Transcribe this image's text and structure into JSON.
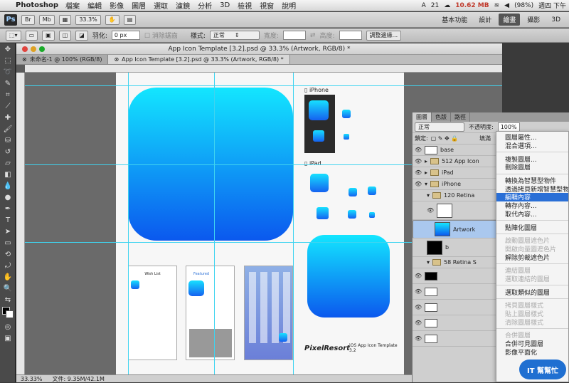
{
  "menubar": {
    "app": "Photoshop",
    "items": [
      "檔案",
      "編輯",
      "影像",
      "圖層",
      "選取",
      "濾鏡",
      "分析",
      "3D",
      "檢視",
      "視窗",
      "說明"
    ],
    "status": {
      "ai": "21",
      "mem": "10.62 MB",
      "battery": "(98%)",
      "clock": "週四 下午"
    }
  },
  "appbar": {
    "logo": "Ps",
    "br": "Br",
    "mb": "Mb",
    "zoom": "33.3%",
    "workspaces": [
      "基本功能",
      "設計",
      "繪畫",
      "攝影",
      "3D"
    ],
    "active_workspace": "繪畫"
  },
  "options": {
    "feather_label": "羽化:",
    "feather_value": "0 px",
    "antialias": "消除鋸齒",
    "style_label": "樣式:",
    "style_value": "正常",
    "width_label": "寬度:",
    "height_label": "高度:",
    "refine_edge": "調整邊緣..."
  },
  "document": {
    "title": "App Icon Template [3.2].psd @ 33.3% (Artwork, RGB/8) *",
    "tabs": [
      {
        "label": "未命名-1 @ 100% (RGB/8)",
        "active": false
      },
      {
        "label": "App Icon Template [3.2].psd @ 33.3% (Artwork, RGB/8) *",
        "active": true
      }
    ],
    "zoom": "33.33%",
    "file_info": "文件: 9.35M/42.1M",
    "artboard_labels": {
      "iphone": "iPhone",
      "ipad": "iPad",
      "brand": "PixelResort",
      "template": "iOS App Icon Template 3.2",
      "wishlist": "Wish List",
      "featured": "Featured"
    }
  },
  "layers_panel": {
    "tabs": [
      "圖層",
      "色版",
      "路徑"
    ],
    "blend_mode": "正常",
    "opacity_label": "不透明度:",
    "opacity_value": "100%",
    "lock_label": "鎖定:",
    "fill_label": "填滿",
    "rows": [
      {
        "name": "base",
        "type": "layer"
      },
      {
        "name": "512 App Icon",
        "type": "folder"
      },
      {
        "name": "iPad",
        "type": "folder"
      },
      {
        "name": "iPhone",
        "type": "folder"
      },
      {
        "name": "120 Retina",
        "type": "folder"
      },
      {
        "name": "",
        "type": "layer"
      },
      {
        "name": "Artwork",
        "type": "layer",
        "selected": true
      },
      {
        "name": "b",
        "type": "layer"
      },
      {
        "name": "58 Retina S",
        "type": "folder"
      },
      {
        "name": "",
        "type": "layer"
      },
      {
        "name": "",
        "type": "layer"
      },
      {
        "name": "",
        "type": "layer"
      },
      {
        "name": "",
        "type": "layer"
      },
      {
        "name": "",
        "type": "layer"
      },
      {
        "name": "",
        "type": "layer"
      }
    ]
  },
  "context_menu": {
    "items": [
      {
        "label": "圖層屬性...",
        "state": "normal"
      },
      {
        "label": "混合選項...",
        "state": "normal"
      },
      {
        "sep": true
      },
      {
        "label": "複製圖層...",
        "state": "normal"
      },
      {
        "label": "刪除圖層",
        "state": "normal"
      },
      {
        "sep": true
      },
      {
        "label": "轉換為智慧型物件",
        "state": "normal"
      },
      {
        "label": "透過拷貝新增智慧型物件",
        "state": "normal"
      },
      {
        "label": "編輯內容",
        "state": "highlight"
      },
      {
        "label": "轉存內容...",
        "state": "normal"
      },
      {
        "label": "取代內容...",
        "state": "normal"
      },
      {
        "sep": true
      },
      {
        "label": "點陣化圖層",
        "state": "normal"
      },
      {
        "sep": true
      },
      {
        "label": "啟動圖層遮色片",
        "state": "disabled"
      },
      {
        "label": "開啟向量圖遮色片",
        "state": "disabled"
      },
      {
        "label": "解除剪裁遮色片",
        "state": "normal"
      },
      {
        "sep": true
      },
      {
        "label": "連結圖層",
        "state": "disabled"
      },
      {
        "label": "選取連結的圖層",
        "state": "disabled"
      },
      {
        "sep": true
      },
      {
        "label": "選取類似的圖層",
        "state": "normal"
      },
      {
        "sep": true
      },
      {
        "label": "拷貝圖層樣式",
        "state": "disabled"
      },
      {
        "label": "貼上圖層樣式",
        "state": "disabled"
      },
      {
        "label": "清除圖層樣式",
        "state": "disabled"
      },
      {
        "sep": true
      },
      {
        "label": "合併圖層",
        "state": "disabled"
      },
      {
        "label": "合併可見圖層",
        "state": "normal"
      },
      {
        "label": "影像平面化",
        "state": "normal"
      }
    ]
  },
  "watermark": "IT 幫幫忙",
  "colors": {
    "accent": "#2a6fd6",
    "guide": "#3fd4f0",
    "icon_top": "#13e6ff",
    "icon_bottom": "#0b58ee"
  }
}
